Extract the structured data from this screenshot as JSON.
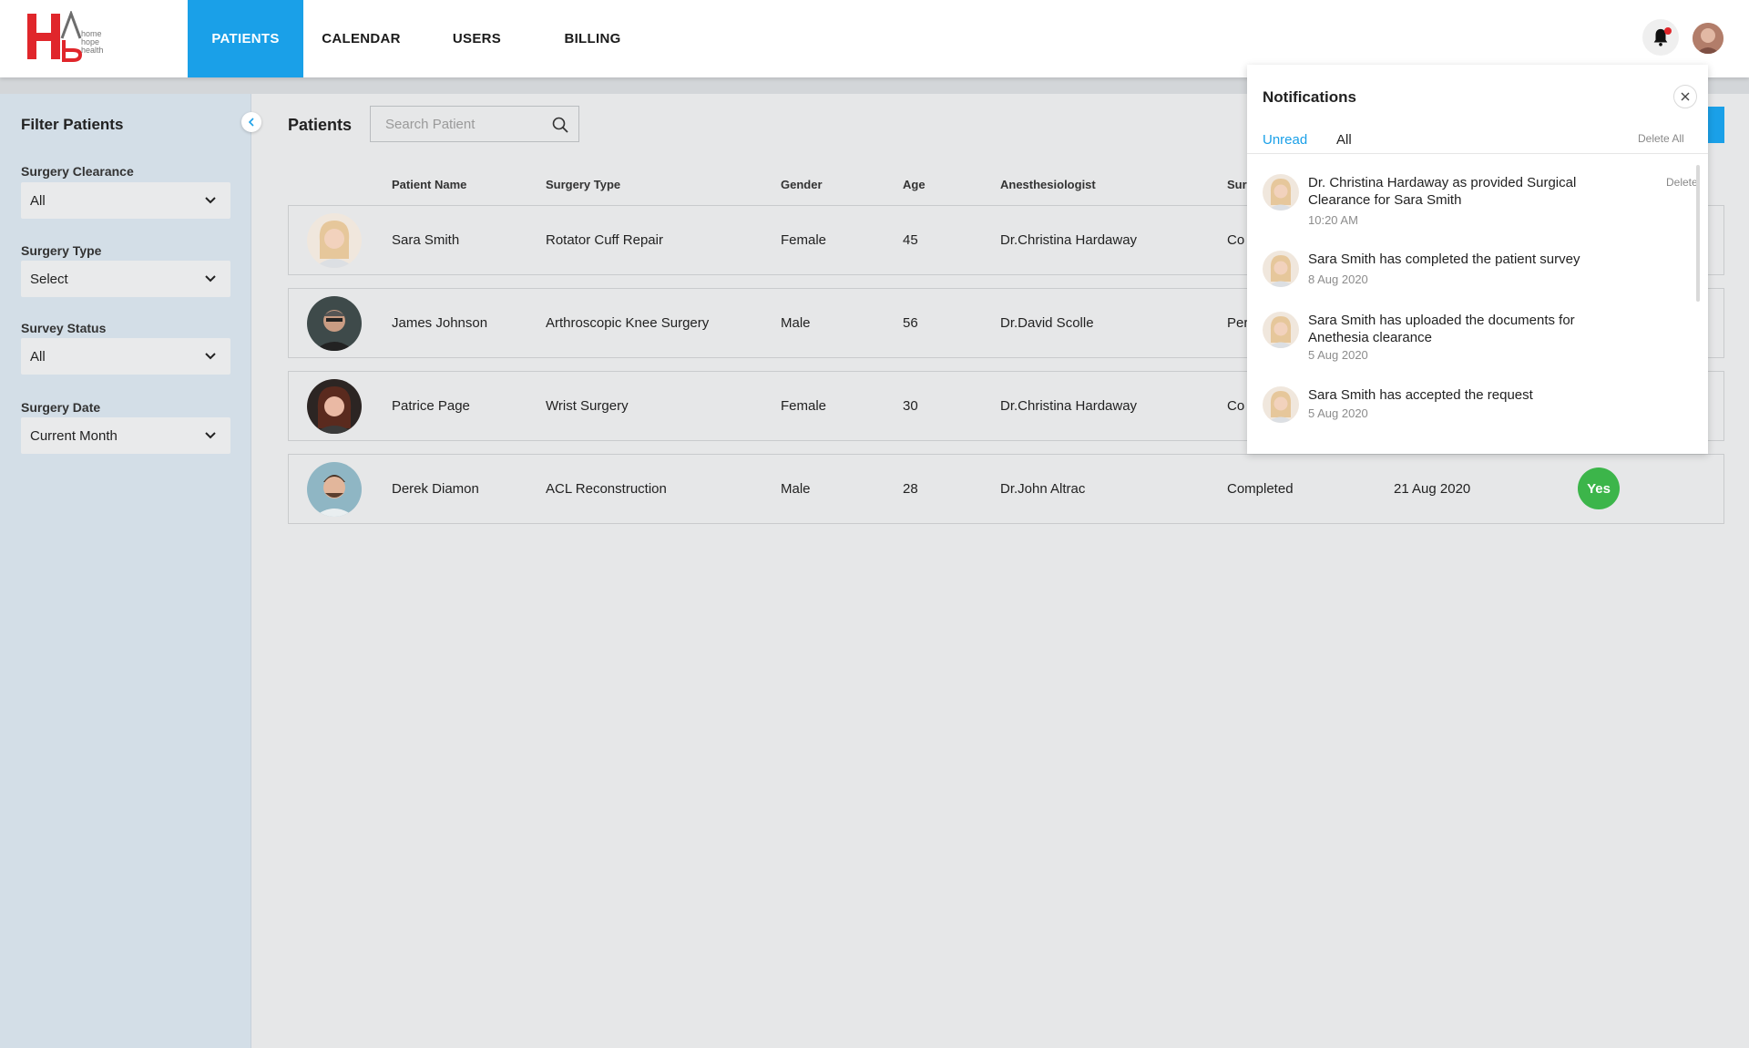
{
  "brand": {
    "logo_text": "home hope health",
    "logo_letters": "HAB",
    "colors": {
      "red": "#e0262b",
      "grey": "#7a7a7a"
    }
  },
  "nav": {
    "items": [
      {
        "label": "PATIENTS",
        "active": true
      },
      {
        "label": "CALENDAR",
        "active": false
      },
      {
        "label": "USERS",
        "active": false
      },
      {
        "label": "BILLING",
        "active": false
      }
    ]
  },
  "header": {
    "bell_icon": "bell-icon",
    "has_unread": true,
    "accent": "#1aa0e8"
  },
  "sidebar": {
    "title": "Filter Patients",
    "filters": [
      {
        "label": "Surgery Clearance",
        "value": "All"
      },
      {
        "label": "Surgery Type",
        "value": "Select"
      },
      {
        "label": "Survey Status",
        "value": "All"
      },
      {
        "label": "Surgery Date",
        "value": "Current Month"
      }
    ]
  },
  "main": {
    "title": "Patients",
    "search": {
      "placeholder": "Search Patient",
      "value": ""
    },
    "columns": [
      "Patient Name",
      "Surgery Type",
      "Gender",
      "Age",
      "Anesthesiologist",
      "Sur"
    ],
    "rows": [
      {
        "name": "Sara Smith",
        "surgery": "Rotator Cuff Repair",
        "gender": "Female",
        "age": "45",
        "anesthesiologist": "Dr.Christina Hardaway",
        "status": "Co",
        "date": "",
        "clearance": ""
      },
      {
        "name": "James Johnson",
        "surgery": "Arthroscopic Knee Surgery",
        "gender": "Male",
        "age": "56",
        "anesthesiologist": "Dr.David Scolle",
        "status": "Per",
        "date": "",
        "clearance": ""
      },
      {
        "name": "Patrice Page",
        "surgery": "Wrist Surgery",
        "gender": "Female",
        "age": "30",
        "anesthesiologist": "Dr.Christina Hardaway",
        "status": "Co",
        "date": "",
        "clearance": ""
      },
      {
        "name": "Derek Diamon",
        "surgery": "ACL Reconstruction",
        "gender": "Male",
        "age": "28",
        "anesthesiologist": "Dr.John Altrac",
        "status": "Completed",
        "date": "21 Aug 2020",
        "clearance": "Yes"
      }
    ]
  },
  "notifications": {
    "title": "Notifications",
    "tabs": [
      {
        "label": "Unread",
        "active": true
      },
      {
        "label": "All",
        "active": false
      }
    ],
    "delete_all": "Delete All",
    "delete_label": "Delete",
    "items": [
      {
        "text": "Dr. Christina Hardaway as provided Surgical Clearance for Sara Smith",
        "time": "10:20 AM"
      },
      {
        "text": "Sara Smith has completed the patient survey",
        "time": "8 Aug 2020"
      },
      {
        "text": "Sara Smith has uploaded the documents for Anethesia clearance",
        "time": "5 Aug 2020"
      },
      {
        "text": "Sara Smith has accepted the request",
        "time": "5 Aug 2020"
      }
    ]
  }
}
